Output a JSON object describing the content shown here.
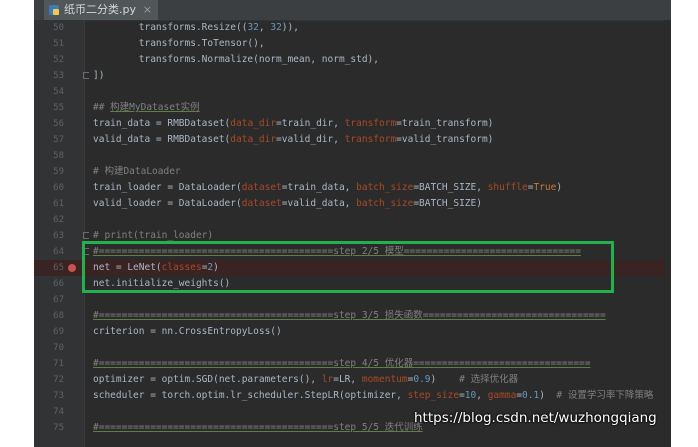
{
  "window": {
    "tab_title": "纸币二分类.py",
    "tab_close": "×",
    "watermark": "https://blog.csdn.net/wuzhongqiang"
  },
  "editor": {
    "breakpoint_line": "65",
    "lines": [
      {
        "num": "50",
        "segments": [
          {
            "t": "        transforms.Resize((",
            "c": ""
          },
          {
            "t": "32",
            "c": "n"
          },
          {
            "t": ", ",
            "c": ""
          },
          {
            "t": "32",
            "c": "n"
          },
          {
            "t": ")),",
            "c": ""
          }
        ]
      },
      {
        "num": "51",
        "segments": [
          {
            "t": "        transforms.ToTensor(),",
            "c": ""
          }
        ]
      },
      {
        "num": "52",
        "segments": [
          {
            "t": "        transforms.Normalize(norm_mean, norm_std),",
            "c": ""
          }
        ]
      },
      {
        "num": "53",
        "fold": true,
        "segments": [
          {
            "t": "])",
            "c": ""
          }
        ]
      },
      {
        "num": "54",
        "segments": []
      },
      {
        "num": "55",
        "segments": [
          {
            "t": "## ",
            "c": "c"
          },
          {
            "t": "构建MyDataset实例",
            "c": "c u"
          }
        ]
      },
      {
        "num": "56",
        "segments": [
          {
            "t": "train_data = RMBDataset(",
            "c": ""
          },
          {
            "t": "data_dir",
            "c": "p"
          },
          {
            "t": "=train_dir, ",
            "c": ""
          },
          {
            "t": "transform",
            "c": "p"
          },
          {
            "t": "=train_transform)",
            "c": ""
          }
        ]
      },
      {
        "num": "57",
        "segments": [
          {
            "t": "valid_data = RMBDataset(",
            "c": ""
          },
          {
            "t": "data_dir",
            "c": "p"
          },
          {
            "t": "=valid_dir, ",
            "c": ""
          },
          {
            "t": "transform",
            "c": "p"
          },
          {
            "t": "=valid_transform)",
            "c": ""
          }
        ]
      },
      {
        "num": "58",
        "segments": []
      },
      {
        "num": "59",
        "segments": [
          {
            "t": "# 构建DataLoader",
            "c": "c"
          }
        ]
      },
      {
        "num": "60",
        "segments": [
          {
            "t": "train_loader = DataLoader(",
            "c": ""
          },
          {
            "t": "dataset",
            "c": "p"
          },
          {
            "t": "=train_data, ",
            "c": ""
          },
          {
            "t": "batch_size",
            "c": "p"
          },
          {
            "t": "=BATCH_SIZE, ",
            "c": ""
          },
          {
            "t": "shuffle",
            "c": "p"
          },
          {
            "t": "=",
            "c": ""
          },
          {
            "t": "True",
            "c": "k"
          },
          {
            "t": ")",
            "c": ""
          }
        ]
      },
      {
        "num": "61",
        "segments": [
          {
            "t": "valid_loader = DataLoader(",
            "c": ""
          },
          {
            "t": "dataset",
            "c": "p"
          },
          {
            "t": "=valid_data, ",
            "c": ""
          },
          {
            "t": "batch_size",
            "c": "p"
          },
          {
            "t": "=BATCH_SIZE)",
            "c": ""
          }
        ]
      },
      {
        "num": "62",
        "segments": []
      },
      {
        "num": "63",
        "fold": true,
        "segments": [
          {
            "t": "# print(train_loader)",
            "c": "c"
          }
        ]
      },
      {
        "num": "64",
        "fold": true,
        "segments": [
          {
            "t": "#=========================================step 2/5 模型===============================",
            "c": "c u"
          }
        ]
      },
      {
        "num": "65",
        "breakpoint": true,
        "segments": [
          {
            "t": "net = LeNet(",
            "c": ""
          },
          {
            "t": "classes",
            "c": "p"
          },
          {
            "t": "=",
            "c": ""
          },
          {
            "t": "2",
            "c": "n"
          },
          {
            "t": ")",
            "c": ""
          }
        ]
      },
      {
        "num": "66",
        "segments": [
          {
            "t": "net.initialize_weights()",
            "c": ""
          }
        ]
      },
      {
        "num": "67",
        "segments": []
      },
      {
        "num": "68",
        "segments": [
          {
            "t": "#=========================================step 3/5 损失函数================================",
            "c": "c u"
          }
        ]
      },
      {
        "num": "69",
        "segments": [
          {
            "t": "criterion = nn.CrossEntropyLoss()",
            "c": ""
          }
        ]
      },
      {
        "num": "70",
        "segments": []
      },
      {
        "num": "71",
        "segments": [
          {
            "t": "#=========================================step 4/5 优化器===============================",
            "c": "c u"
          }
        ]
      },
      {
        "num": "72",
        "segments": [
          {
            "t": "optimizer = optim.SGD(net.parameters(), ",
            "c": ""
          },
          {
            "t": "lr",
            "c": "p"
          },
          {
            "t": "=LR, ",
            "c": ""
          },
          {
            "t": "momentum",
            "c": "p"
          },
          {
            "t": "=",
            "c": ""
          },
          {
            "t": "0.9",
            "c": "n"
          },
          {
            "t": ")    ",
            "c": ""
          },
          {
            "t": "# 选择优化器",
            "c": "c"
          }
        ]
      },
      {
        "num": "73",
        "segments": [
          {
            "t": "scheduler = torch.optim.lr_scheduler.StepLR(optimizer, ",
            "c": ""
          },
          {
            "t": "step_size",
            "c": "p"
          },
          {
            "t": "=",
            "c": ""
          },
          {
            "t": "10",
            "c": "n"
          },
          {
            "t": ", ",
            "c": ""
          },
          {
            "t": "gamma",
            "c": "p"
          },
          {
            "t": "=",
            "c": ""
          },
          {
            "t": "0.1",
            "c": "n"
          },
          {
            "t": ")  ",
            "c": ""
          },
          {
            "t": "# 设置学习率下降策略",
            "c": "c"
          }
        ]
      },
      {
        "num": "74",
        "segments": []
      },
      {
        "num": "75",
        "segments": [
          {
            "t": "#=========================================step 5/5 迭代训练",
            "c": "c u"
          }
        ]
      }
    ]
  }
}
